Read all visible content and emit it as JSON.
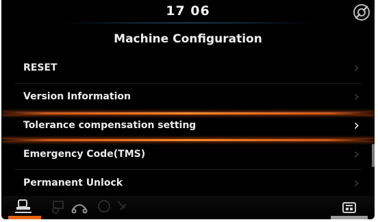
{
  "status": {
    "time": "17 06",
    "icon": "tool-gear-icon"
  },
  "page": {
    "title": "Machine Configuration"
  },
  "menu": {
    "items": [
      {
        "label": "RESET",
        "selected": false
      },
      {
        "label": "Version Information",
        "selected": false
      },
      {
        "label": "Tolerance compensation setting",
        "selected": true
      },
      {
        "label": "Emergency Code(TMS)",
        "selected": false
      },
      {
        "label": "Permanent Unlock",
        "selected": false
      }
    ]
  },
  "bottom_bar": {
    "tabs": [
      {
        "name": "machine-icon",
        "active": true
      },
      {
        "name": "settings-device-icon",
        "active": false
      }
    ],
    "faint_icons": [
      "tractor-icon",
      "road-icon",
      "engine-icon",
      "wrench-icon"
    ]
  },
  "colors": {
    "background": "#000000",
    "highlight": "#ff8a2e",
    "text": "#ececec",
    "accent_line": "#2a6d95"
  }
}
